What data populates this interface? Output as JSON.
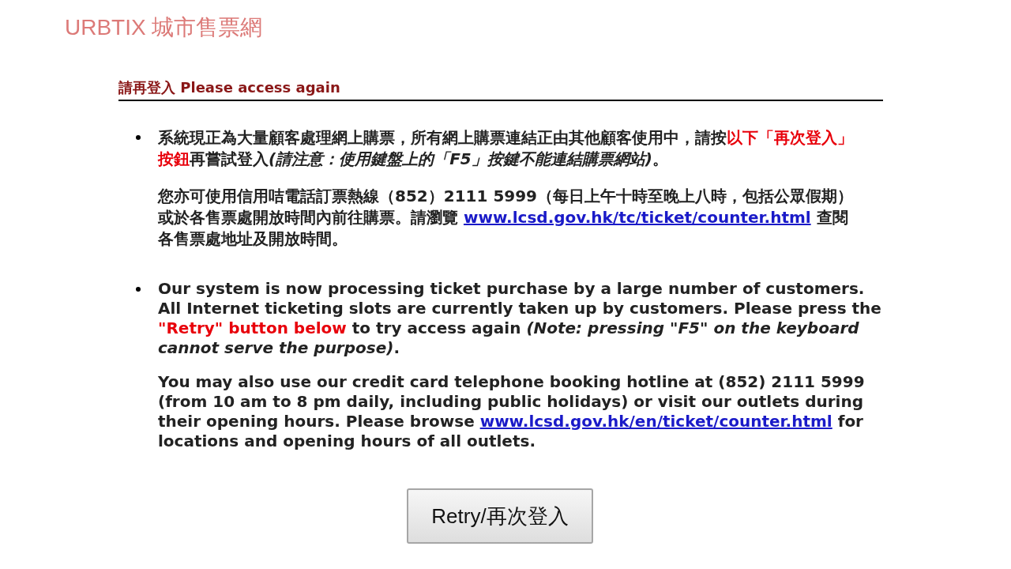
{
  "logo": "URBTIX 城市售票網",
  "heading": "請再登入 Please access again",
  "notices": [
    {
      "kind": "chinese",
      "paragraphs": [
        [
          {
            "kind": "text",
            "text": "系統現正為大量顧客處理網上購票，所有網上購票連結正由其他顧客使用中，請按"
          },
          {
            "kind": "highlight",
            "text": "以下「再次登入」按鈕"
          },
          {
            "kind": "text",
            "text": "再嘗試登入"
          },
          {
            "kind": "note",
            "text": "(請注意：使用鍵盤上的「F5」按鍵不能連結購票網站)"
          },
          {
            "kind": "text",
            "text": "。"
          }
        ],
        [
          {
            "kind": "text",
            "text": "您亦可使用信用咭電話訂票熱線（852）2111 5999（每日上午十時至晚上八時，包括公眾假期）或於各售票處開放時間內前往購票。請瀏覽 "
          },
          {
            "kind": "link",
            "text": "www.lcsd.gov.hk/tc/ticket/counter.html"
          },
          {
            "kind": "text",
            "text": " 查閱各售票處地址及開放時間。"
          }
        ]
      ]
    },
    {
      "kind": "english",
      "paragraphs": [
        [
          {
            "kind": "text",
            "text": "Our system is now processing ticket purchase by a large number of customers. All Internet ticketing slots are currently taken up by customers. Please press the "
          },
          {
            "kind": "highlight",
            "text": "\"Retry\" button below"
          },
          {
            "kind": "text",
            "text": " to try access again "
          },
          {
            "kind": "note",
            "text": "(Note: pressing \"F5\" on the keyboard cannot serve the purpose)"
          },
          {
            "kind": "text",
            "text": "."
          }
        ],
        [
          {
            "kind": "text",
            "text": "You may also use our credit card telephone booking hotline at (852) 2111 5999 (from 10 am to 8 pm daily, including public holidays) or visit our outlets during their opening hours. Please browse "
          },
          {
            "kind": "link",
            "text": "www.lcsd.gov.hk/en/ticket/counter.html"
          },
          {
            "kind": "text",
            "text": " for locations and opening hours of all outlets."
          }
        ]
      ]
    }
  ],
  "button": {
    "label": "Retry/再次登入"
  }
}
